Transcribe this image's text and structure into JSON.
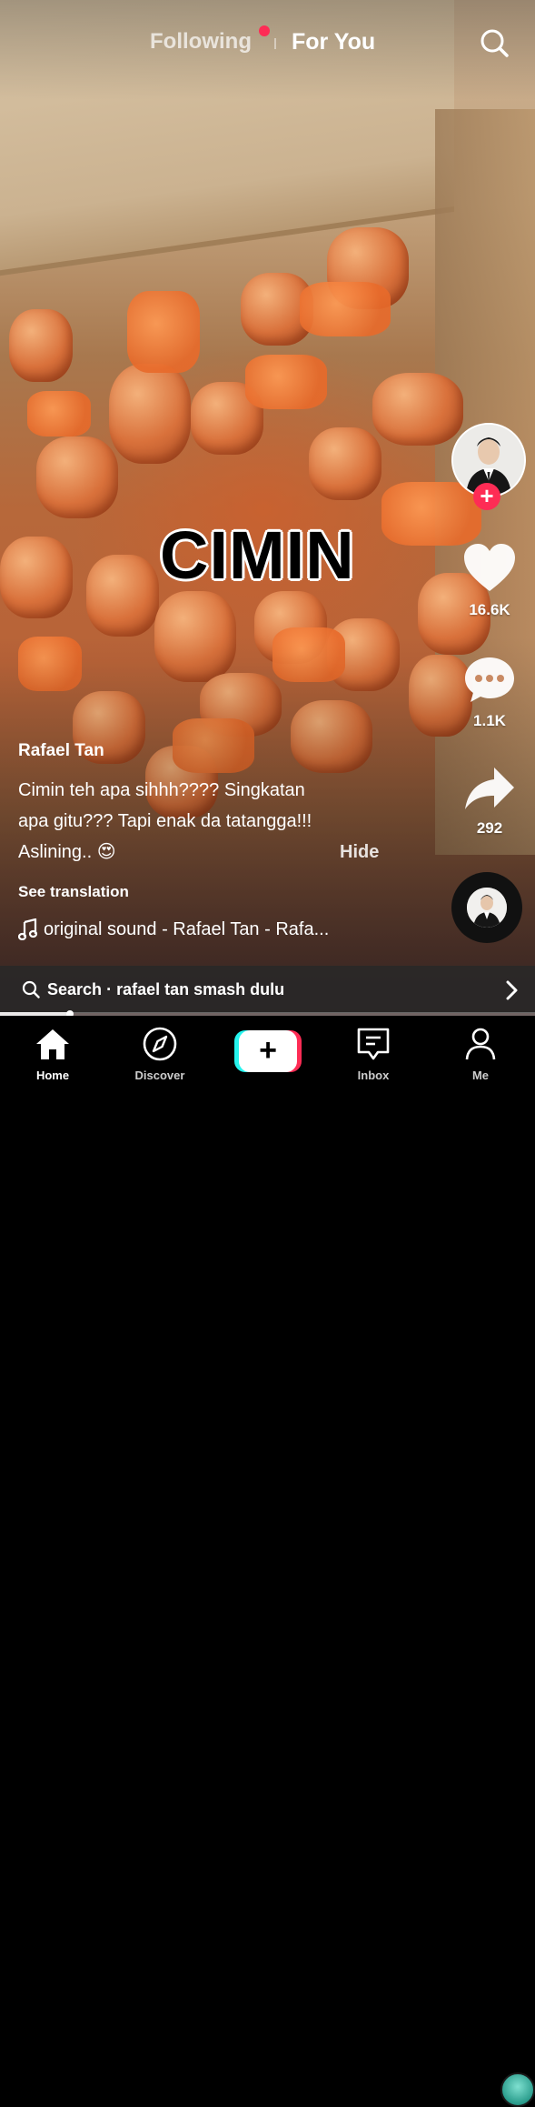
{
  "header": {
    "tab_following": "Following",
    "tab_for_you": "For You",
    "search_icon": "search-icon"
  },
  "video": {
    "overlay_text": "CIMIN",
    "description": "video-frame"
  },
  "rail": {
    "like_count": "16.6K",
    "comment_count": "1.1K",
    "share_count": "292"
  },
  "post": {
    "username": "Rafael Tan",
    "caption_line1": "Cimin teh apa sihhh???? Singkatan",
    "caption_line2": "apa gitu??? Tapi enak da tatangga!!!",
    "caption_line3": "Aslining.. 😍",
    "hide_label": "Hide",
    "see_translation": "See translation",
    "sound": "original sound - Rafael Tan - Rafa..."
  },
  "search_bar": {
    "prefix": "Search",
    "separator": "·",
    "query": "rafael tan smash dulu"
  },
  "playback": {
    "progress_fraction": 0.13
  },
  "nav": {
    "home": "Home",
    "discover": "Discover",
    "create": "+",
    "inbox": "Inbox",
    "me": "Me"
  },
  "colors": {
    "accent_red": "#fe2c55",
    "accent_cyan": "#25f4ee",
    "nav_bg": "#000000"
  }
}
